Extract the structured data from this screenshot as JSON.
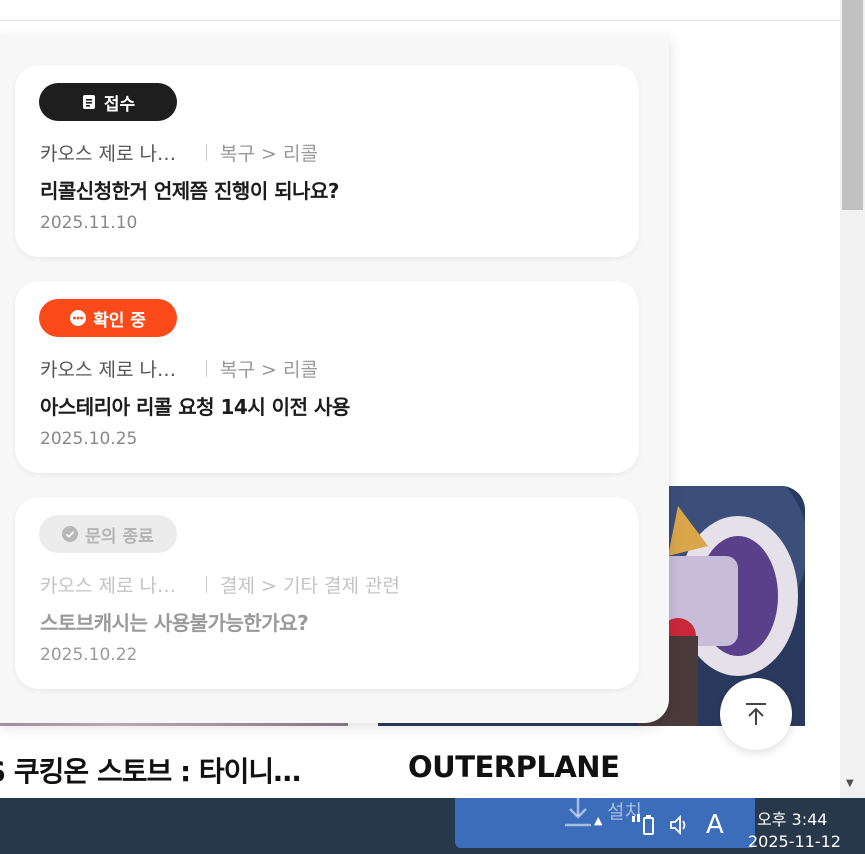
{
  "tickets": [
    {
      "status": "접수",
      "game": "카오스 제로 나…",
      "category": "복구 > 리콜",
      "title": "리콜신청한거 언제쯤 진행이 되나요?",
      "date": "2025.11.10"
    },
    {
      "status": "확인 중",
      "game": "카오스 제로 나…",
      "category": "복구 > 리콜",
      "title": "아스테리아 리콜 요청 14시 이전 사용",
      "date": "2025.10.25"
    },
    {
      "status": "문의 종료",
      "game": "카오스 제로 나…",
      "category": "결제 > 기타 결제 관련",
      "title": "스토브캐시는 사용불가능한가요?",
      "date": "2025.10.22"
    }
  ],
  "games": {
    "left_title": "S 쿠킹온 스토브 : 타이니…",
    "right_title": "OUTERPLANE"
  },
  "install": {
    "label": "설치"
  },
  "taskbar": {
    "ime": "A",
    "time": "오후 3:44",
    "date": "2025-11-12"
  },
  "colors": {
    "received": "#1e1e1e",
    "checking": "#fa4a1a",
    "closed": "#ececec",
    "taskbar": "#26384a",
    "install": "#3d70c0"
  }
}
